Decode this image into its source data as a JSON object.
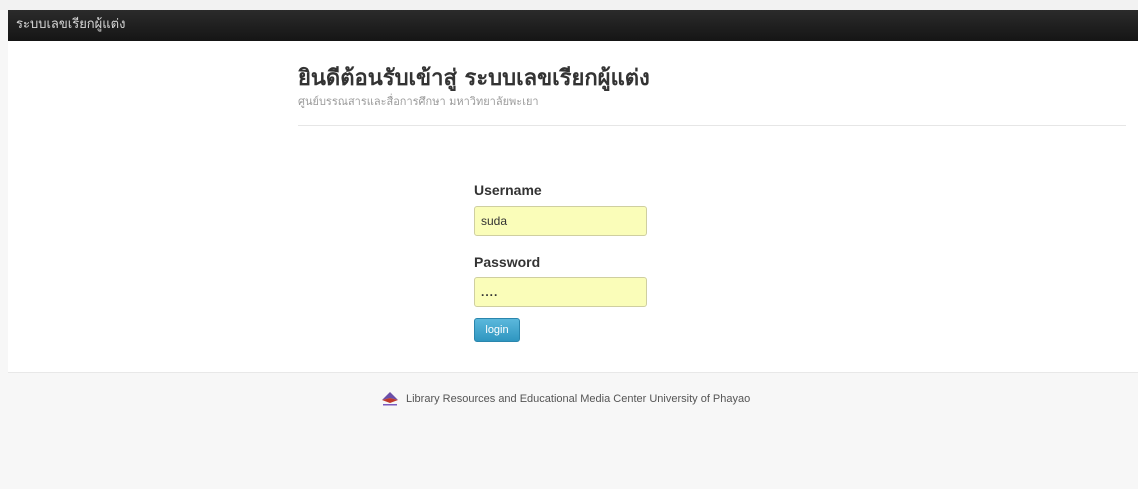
{
  "navbar": {
    "brand": "ระบบเลขเรียกผู้แต่ง"
  },
  "hero": {
    "title": "ยินดีต้อนรับเข้าสู่ ระบบเลขเรียกผู้แต่ง",
    "subtitle": "ศูนย์บรรณสารและสื่อการศึกษา มหาวิทยาลัยพะเยา"
  },
  "login_form": {
    "username_label": "Username",
    "username_value": "suda",
    "password_label": "Password",
    "password_value": "....",
    "login_button": "login"
  },
  "footer": {
    "logo_icon": "library-logo-icon",
    "text": "Library Resources and Educational Media Center University of Phayao"
  }
}
